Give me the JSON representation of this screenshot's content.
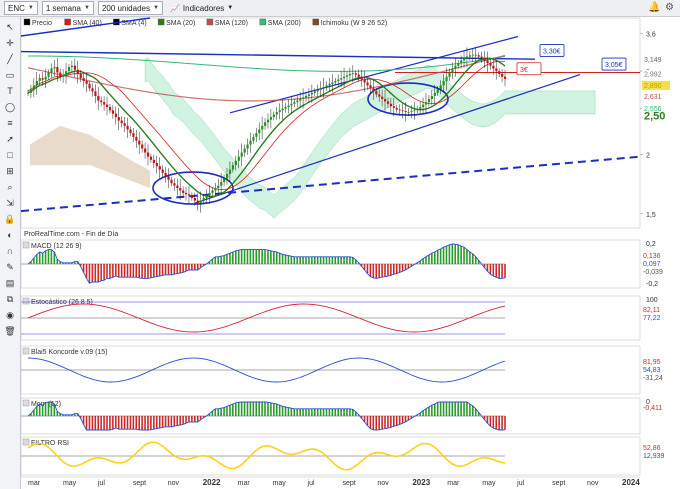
{
  "toolbar": {
    "ticker": "ENC",
    "period": "1 semana",
    "units": "200 unidades",
    "indicators_label": "Indicadores"
  },
  "legend": [
    {
      "label": "Precio",
      "color": "#000000"
    },
    {
      "label": "SMA (40)",
      "color": "#d62020"
    },
    {
      "label": "SMA (4)",
      "color": "#000000"
    },
    {
      "label": "SMA (20)",
      "color": "#2f7d1c"
    },
    {
      "label": "SMA (120)",
      "color": "#c05050"
    },
    {
      "label": "SMA (200)",
      "color": "#33bb77"
    },
    {
      "label": "Ichimoku (W 9 26 52)",
      "color": "#7a4a2a"
    }
  ],
  "colors": {
    "up": "#1a9a1a",
    "down": "#cc1111",
    "trend": "#1a2ec2",
    "red_line": "#d42020",
    "cloud": "#c9f2dc"
  },
  "chart_data": {
    "type": "candlestick",
    "x_tick_labels": [
      "mar",
      "may",
      "jul",
      "sept",
      "nov",
      "2022",
      "mar",
      "may",
      "jul",
      "sept",
      "nov",
      "2023",
      "mar",
      "may",
      "jul",
      "sept",
      "nov",
      "2024"
    ],
    "y_tick_labels": [
      "3,6",
      "3",
      "2,5",
      "2",
      "1,5"
    ],
    "ylim": [
      1.4,
      3.7
    ],
    "price_axis_log": true,
    "last_price_labels": [
      "3,149",
      "2,992",
      "2,890",
      "2,631",
      "2,556",
      "2,50"
    ],
    "annotations": [
      "3,30€",
      "3€",
      "3,05€"
    ],
    "source_label": "ProRealTime.com - Fin de Día",
    "weekly_close": [
      2.7,
      2.74,
      2.8,
      2.86,
      2.9,
      2.88,
      2.92,
      2.98,
      3.04,
      3.06,
      2.98,
      2.92,
      2.94,
      3.0,
      3.06,
      3.08,
      3.02,
      2.96,
      2.9,
      2.86,
      2.82,
      2.76,
      2.72,
      2.66,
      2.6,
      2.58,
      2.55,
      2.52,
      2.48,
      2.44,
      2.4,
      2.36,
      2.33,
      2.3,
      2.26,
      2.22,
      2.18,
      2.14,
      2.1,
      2.06,
      2.02,
      1.98,
      1.95,
      1.92,
      1.89,
      1.86,
      1.83,
      1.8,
      1.77,
      1.74,
      1.72,
      1.7,
      1.68,
      1.66,
      1.65,
      1.64,
      1.62,
      1.6,
      1.58,
      1.6,
      1.62,
      1.64,
      1.66,
      1.68,
      1.7,
      1.72,
      1.75,
      1.78,
      1.82,
      1.86,
      1.9,
      1.94,
      1.98,
      2.02,
      2.06,
      2.1,
      2.14,
      2.18,
      2.22,
      2.26,
      2.3,
      2.34,
      2.37,
      2.4,
      2.43,
      2.46,
      2.48,
      2.5,
      2.52,
      2.54,
      2.56,
      2.58,
      2.6,
      2.62,
      2.64,
      2.66,
      2.68,
      2.7,
      2.72,
      2.74,
      2.76,
      2.78,
      2.8,
      2.82,
      2.84,
      2.86,
      2.88,
      2.9,
      2.92,
      2.94,
      2.96,
      2.97,
      2.95,
      2.92,
      2.88,
      2.84,
      2.8,
      2.76,
      2.72,
      2.68,
      2.65,
      2.62,
      2.59,
      2.56,
      2.53,
      2.51,
      2.49,
      2.48,
      2.47,
      2.46,
      2.46,
      2.47,
      2.48,
      2.5,
      2.52,
      2.55,
      2.58,
      2.62,
      2.66,
      2.7,
      2.75,
      2.8,
      2.86,
      2.92,
      2.98,
      3.04,
      3.08,
      3.12,
      3.16,
      3.2,
      3.22,
      3.24,
      3.25,
      3.24,
      3.22,
      3.2,
      3.16,
      3.12,
      3.08,
      3.04,
      3.0,
      2.96,
      2.92,
      2.89
    ]
  },
  "indicators": [
    {
      "label": "MACD (12 26 9)",
      "values": [
        "0,136",
        "0,097",
        "-0,039"
      ],
      "ticks": [
        "0,2",
        "-0,2"
      ]
    },
    {
      "label": "Estocástico (26 8 5)",
      "values": [
        "82,11",
        "77,22"
      ],
      "ticks": [
        "100"
      ]
    },
    {
      "label": "Blai5 Koncorde v.09 (15)",
      "values": [
        "81,95",
        "54,83",
        "-31,24"
      ],
      "ticks": []
    },
    {
      "label": "Mom (12)",
      "values": [
        "-0,411"
      ],
      "ticks": [
        "0"
      ]
    },
    {
      "label": "FILTRO RSI",
      "values": [
        "52,86",
        "12,939"
      ],
      "ticks": []
    }
  ]
}
